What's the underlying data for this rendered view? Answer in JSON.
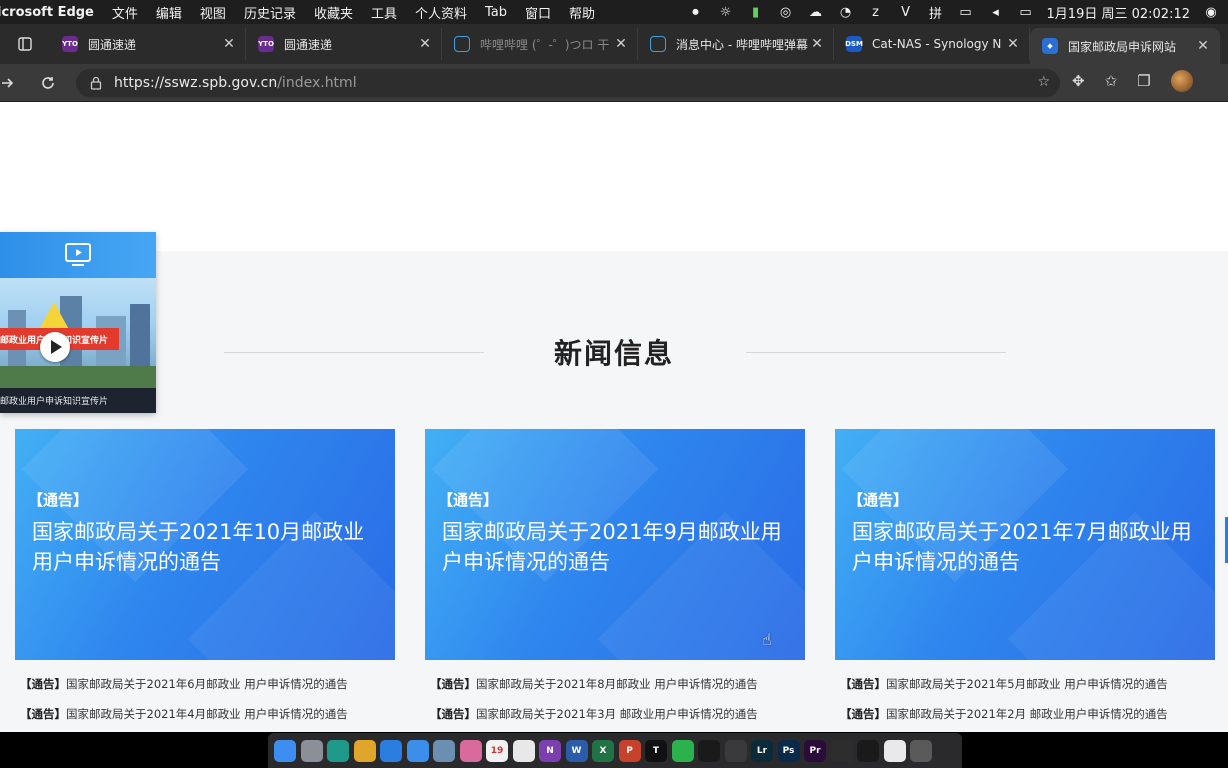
{
  "menubar": {
    "app_name": "icrosoft Edge",
    "menus": [
      "文件",
      "编辑",
      "视图",
      "历史记录",
      "收藏夹",
      "工具",
      "个人资料",
      "Tab",
      "窗口",
      "帮助"
    ],
    "clock": "1月19日 周三  02:02:12"
  },
  "tabs": [
    {
      "title": "圆通速递",
      "fav_color": "#6a2c8f",
      "active": false
    },
    {
      "title": "圆通速递",
      "fav_color": "#6a2c8f",
      "active": false
    },
    {
      "title": "哔哩哔哩 (゜-゜)つロ 干",
      "fav_color": "#3aa1dc",
      "active": false,
      "dim": true
    },
    {
      "title": "消息中心 - 哔哩哔哩弹幕",
      "fav_color": "#3aa1dc",
      "active": false
    },
    {
      "title": "Cat-NAS - Synology N",
      "fav_color": "#1b59c4",
      "fav_text": "DSM",
      "active": false
    },
    {
      "title": "国家邮政局申诉网站",
      "fav_color": "#2a6fd6",
      "active": true
    }
  ],
  "address": {
    "host": "https://sswz.spb.gov.cn",
    "path": "/index.html"
  },
  "section": {
    "heading": "新闻信息"
  },
  "video": {
    "banner_text": "邮政业用户申诉知识宣传片",
    "caption": "邮政业用户申诉知识宣传片"
  },
  "cards": [
    {
      "tag": "【通告】",
      "headline": "国家邮政局关于2021年10月邮政业用户申诉情况的通告"
    },
    {
      "tag": "【通告】",
      "headline": "国家邮政局关于2021年9月邮政业用户申诉情况的通告"
    },
    {
      "tag": "【通告】",
      "headline": "国家邮政局关于2021年7月邮政业用户申诉情况的通告"
    }
  ],
  "news_lines": [
    [
      {
        "tag": "【通告】",
        "text": "国家邮政局关于2021年6月邮政业 用户申诉情况的通告"
      },
      {
        "tag": "【通告】",
        "text": "国家邮政局关于2021年4月邮政业 用户申诉情况的通告"
      }
    ],
    [
      {
        "tag": "【通告】",
        "text": "国家邮政局关于2021年8月邮政业 用户申诉情况的通告"
      },
      {
        "tag": "【通告】",
        "text": "国家邮政局关于2021年3月 邮政业用户申诉情况的通告"
      }
    ],
    [
      {
        "tag": "【通告】",
        "text": "国家邮政局关于2021年5月邮政业 用户申诉情况的通告"
      },
      {
        "tag": "【通告】",
        "text": "国家邮政局关于2021年2月 邮政业用户申诉情况的通告"
      }
    ]
  ],
  "dock": {
    "apps": [
      {
        "name": "finder",
        "color": "#3d8ef0"
      },
      {
        "name": "launchpad",
        "color": "#8a8f98"
      },
      {
        "name": "edge",
        "color": "#1f9a8a"
      },
      {
        "name": "chrome",
        "color": "#e0a52b"
      },
      {
        "name": "safari",
        "color": "#2b7de0"
      },
      {
        "name": "messages",
        "color": "#3b8fe8"
      },
      {
        "name": "preview",
        "color": "#6a8fb0"
      },
      {
        "name": "photos",
        "color": "#d96a9c"
      },
      {
        "name": "calendar",
        "color": "#f2f2f2",
        "text": "19"
      },
      {
        "name": "notes",
        "color": "#e8e8e8"
      },
      {
        "name": "onenote",
        "color": "#7b3fb0",
        "text": "N"
      },
      {
        "name": "word",
        "color": "#2a5caa",
        "text": "W"
      },
      {
        "name": "excel",
        "color": "#217346",
        "text": "X"
      },
      {
        "name": "powerpoint",
        "color": "#c8412a",
        "text": "P"
      },
      {
        "name": "typora",
        "color": "#111111",
        "text": "T"
      },
      {
        "name": "wechat",
        "color": "#2bb24c"
      },
      {
        "name": "qq",
        "color": "#1a1a1a"
      },
      {
        "name": "final-cut",
        "color": "#3a3a3a"
      },
      {
        "name": "lightroom",
        "color": "#0b2a3a",
        "text": "Lr"
      },
      {
        "name": "photoshop",
        "color": "#0b2a4a",
        "text": "Ps"
      },
      {
        "name": "premiere",
        "color": "#2a0b3a",
        "text": "Pr"
      },
      {
        "name": "activity-monitor",
        "color": "#2d2d2d"
      },
      {
        "name": "terminal",
        "color": "#1a1a1a"
      },
      {
        "name": "documents",
        "color": "#e9e9e9"
      },
      {
        "name": "trash",
        "color": "#5a5a5a"
      }
    ]
  }
}
